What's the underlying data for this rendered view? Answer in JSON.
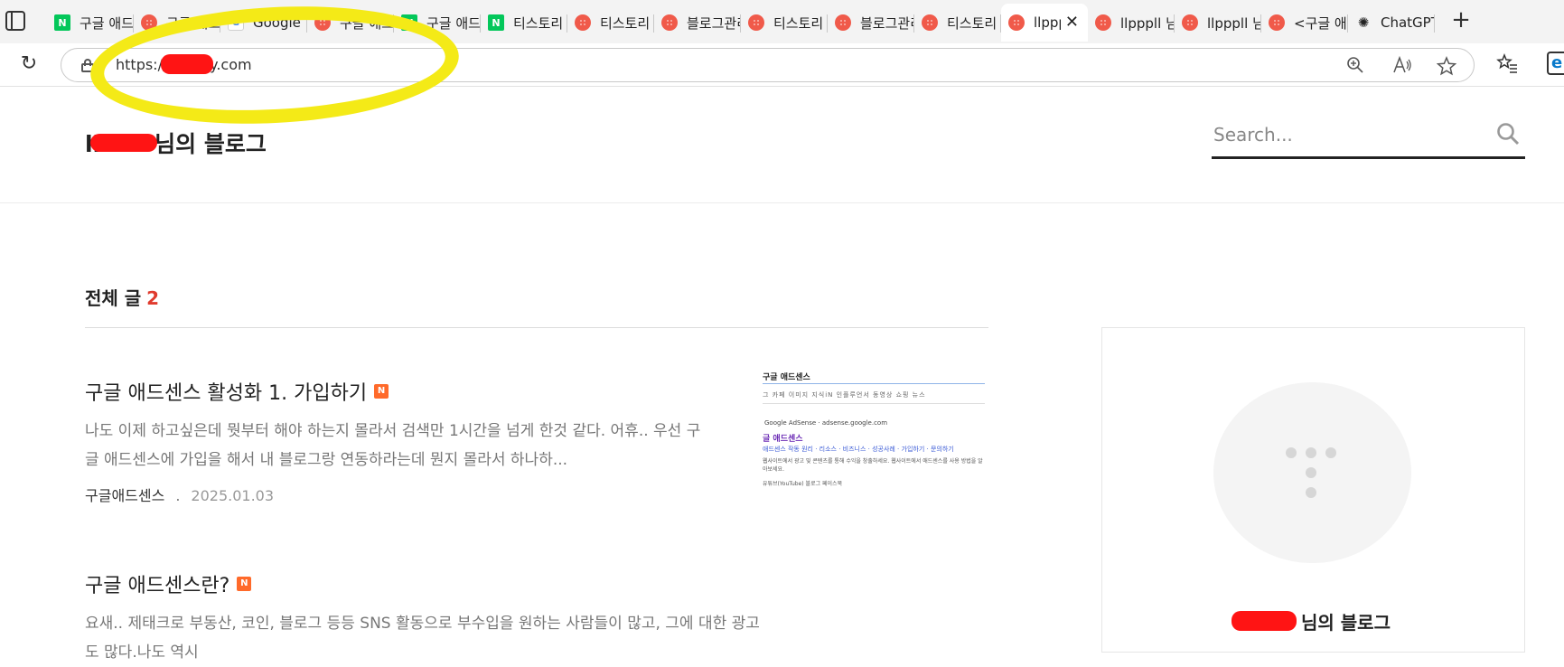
{
  "browser": {
    "tabs": [
      {
        "favicon": "naver",
        "title": "구글 애드센스"
      },
      {
        "favicon": "tistory",
        "title": "구글 애드센스"
      },
      {
        "favicon": "google",
        "title": "Google"
      },
      {
        "favicon": "tistory",
        "title": "구글 애드센스"
      },
      {
        "favicon": "naver",
        "title": "구글 애드센스"
      },
      {
        "favicon": "naver",
        "title": "티스토리"
      },
      {
        "favicon": "tistory",
        "title": "티스토리"
      },
      {
        "favicon": "tistory",
        "title": "블로그관리"
      },
      {
        "favicon": "tistory",
        "title": "티스토리"
      },
      {
        "favicon": "tistory",
        "title": "블로그관리"
      },
      {
        "favicon": "tistory",
        "title": "티스토리"
      },
      {
        "favicon": "tistory",
        "title": "llpppll",
        "active": true
      },
      {
        "favicon": "tistory",
        "title": "llpppll 님"
      },
      {
        "favicon": "tistory",
        "title": "llpppll 님"
      },
      {
        "favicon": "tistory",
        "title": "<구글 애드"
      },
      {
        "favicon": "chatgpt",
        "title": "ChatGPT"
      }
    ],
    "url": "https://        tistory.com",
    "new_tab_label": "+",
    "reload_label": "↻",
    "colors": {
      "annotation": "#f4ea17",
      "redaction": "#ff1414"
    }
  },
  "blog": {
    "title_prefix": "ll",
    "title_suffix": "님의 블로그",
    "search": {
      "placeholder": "Search..."
    }
  },
  "section": {
    "title": "전체 글",
    "count": "2"
  },
  "posts": [
    {
      "title": "구글 애드센스 활성화 1. 가입하기",
      "badge": "N",
      "excerpt": "나도 이제 하고싶은데 뭣부터 해야 하는지 몰라서 검색만 1시간을 넘게 한것 같다. 어휴.. 우선 구글 애드센스에 가입을 해서 내 블로그랑 연동하라는데 뭔지 몰라서 하나하...",
      "category": "구글애드센스",
      "separator": ".",
      "date": "2025.01.03"
    },
    {
      "title": "구글 애드센스란?",
      "badge": "N",
      "excerpt": "요새.. 제태크로 부동산, 코인, 블로그 등등  SNS 활동으로 부수입을 원하는 사람들이 많고, 그에 대한 광고도 많다.나도 역시"
    }
  ],
  "thumbnail": {
    "heading": "구글 애드센스",
    "tabs": "그  카페  이미지  지식iN  인플루언서  동영상  쇼핑  뉴스",
    "source": "Google AdSense · adsense.google.com",
    "link": "글 애드센스",
    "sub": "애드센스 작동 원리 · 리소스 · 비즈니스 · 성공사례 · 가입하기 · 문의하기",
    "desc": "웹사이트에서 광고 및 콘텐츠를 통해 수익을 창출하세요. 웹사이트에서 애드센스를 사용 방법을 알아보세요.",
    "footer": "유튜브(YouTube)   블로그   페이스북"
  },
  "profile": {
    "name_suffix": "님의 블로그"
  }
}
